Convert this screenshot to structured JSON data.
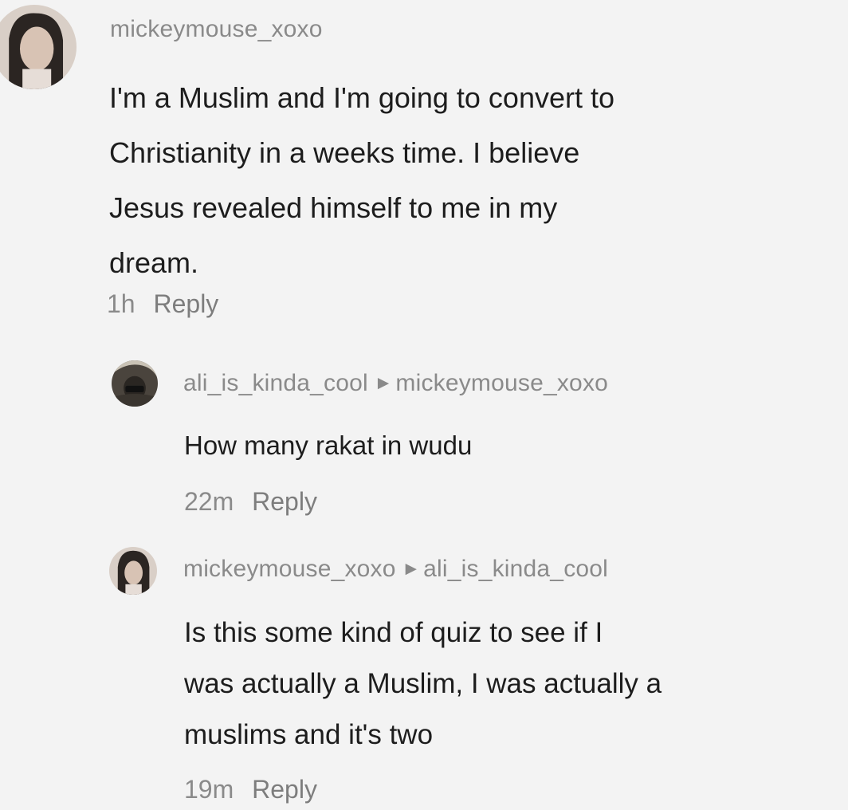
{
  "comments": [
    {
      "author": "mickeymouse_xoxo",
      "text": "I'm a Muslim and I'm going to convert to\nChristianity in a weeks time. I believe\nJesus revealed himself to me in my\ndream.",
      "time": "1h",
      "reply_label": "Reply",
      "avatar_icon": "user-avatar-icon"
    },
    {
      "author": "ali_is_kinda_cool",
      "reply_to": "mickeymouse_xoxo",
      "text": "How many rakat in wudu",
      "time": "22m",
      "reply_label": "Reply",
      "avatar_icon": "user-avatar-icon"
    },
    {
      "author": "mickeymouse_xoxo",
      "reply_to": "ali_is_kinda_cool",
      "text": "Is this some kind of quiz to see if I\nwas actually a Muslim, I was actually a\nmuslims and it's two",
      "time": "19m",
      "reply_label": "Reply",
      "avatar_icon": "user-avatar-icon"
    }
  ],
  "colors": {
    "background": "#f3f3f3",
    "username": "#8a8a8a",
    "body_text": "#1d1d1d",
    "meta": "#8a8a8a"
  }
}
